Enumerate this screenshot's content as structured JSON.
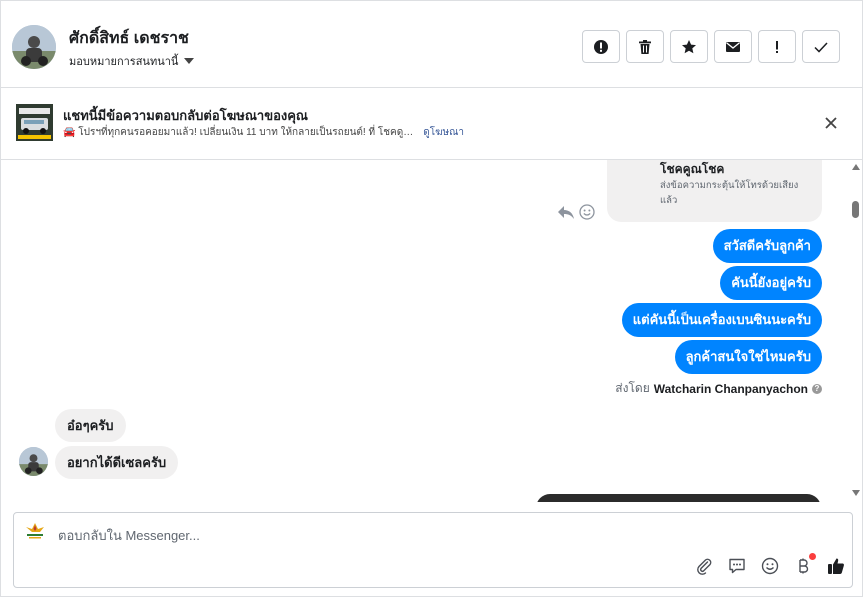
{
  "header": {
    "contact_name": "ศักดิ์สิทธ์ เดชราช",
    "assign_label": "มอบหมายการสนทนานี้",
    "actions": [
      {
        "name": "mark-spam",
        "icon": "alert-circle-icon"
      },
      {
        "name": "delete",
        "icon": "trash-icon"
      },
      {
        "name": "star",
        "icon": "star-icon"
      },
      {
        "name": "mark-unread",
        "icon": "envelope-icon"
      },
      {
        "name": "follow-up",
        "icon": "exclamation-icon"
      },
      {
        "name": "mark-done",
        "icon": "check-icon"
      }
    ]
  },
  "ad_banner": {
    "title": "แชทนี้มีข้อความตอบกลับต่อโฆษณาของคุณ",
    "subtitle": "🚘 โปรฯที่ทุกคนรอคอยมาแล้ว! เปลี่ยนเงิน 11 บาท ให้กลายเป็นรถยนต์! ที่ โชคดู…",
    "link": "ดูโฆษณา"
  },
  "messages": {
    "system_card_title": "โชคคูณโชค",
    "system_card_desc": "ส่งข้อความกระตุ้นให้โทรด้วยเสียงแล้ว",
    "outgoing": [
      "สวัสดีครับลูกค้า",
      "คันนี้ยังอยู่ครับ",
      "แต่คันนี้เป็นเครื่องเบนซินนะครับ",
      "ลูกค้าสนใจใช่ไหมครับ"
    ],
    "sent_by_prefix": "ส่งโดย",
    "sent_by_name": "Watcharin Chanpanyachon",
    "incoming": [
      "อ๋อๆครับ",
      "อยากได้ดีเซลครับ"
    ]
  },
  "composer": {
    "placeholder": "ตอบกลับใน Messenger...",
    "tools": [
      "paperclip-icon",
      "saved-reply-icon",
      "emoji-icon",
      "baht-icon",
      "thumbs-up-icon"
    ]
  },
  "colors": {
    "accent": "#0084ff",
    "incoming_bubble": "#f1f0f0",
    "link": "#385898"
  }
}
